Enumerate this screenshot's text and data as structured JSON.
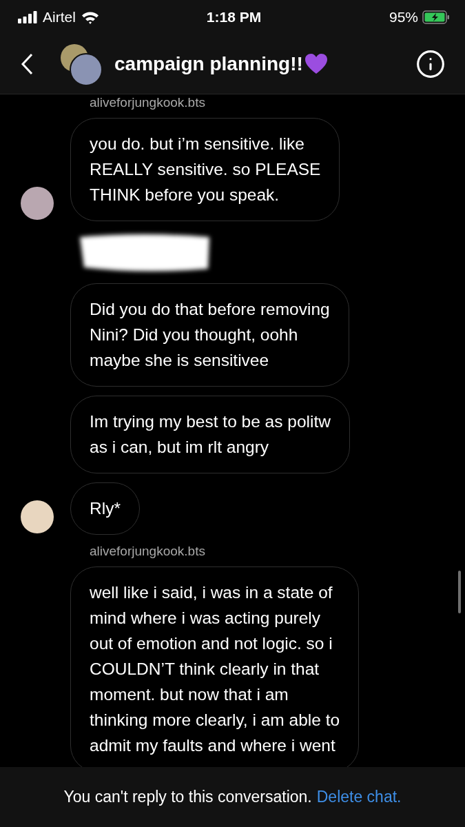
{
  "status_bar": {
    "carrier": "Airtel",
    "time": "1:18 PM",
    "battery": "95%"
  },
  "header": {
    "title": "campaign planning!!"
  },
  "messages": [
    {
      "kind": "sender",
      "text": "aliveforjungkook.bts"
    },
    {
      "kind": "bubble",
      "text": "you do. but i’m sensitive. like\nREALLY sensitive. so PLEASE\nTHINK before you speak.",
      "avatar": {
        "color": "#b9a7b0"
      }
    },
    {
      "kind": "redaction"
    },
    {
      "kind": "bubble",
      "text": "Did you do that before removing\nNini? Did you thought, oohh\nmaybe she is sensitivee"
    },
    {
      "kind": "bubble",
      "text": "Im trying my best to be as politw\nas i can, but im rlt angry"
    },
    {
      "kind": "bubble",
      "text": "Rly*",
      "avatar": {
        "color": "#e8d6bf"
      }
    },
    {
      "kind": "sender",
      "text": "aliveforjungkook.bts"
    },
    {
      "kind": "bubble",
      "text": "well like i said, i was in a state of\nmind where i was acting purely\nout of emotion and not logic. so i\nCOULDN’T think clearly in that\nmoment. but now that i am\nthinking more clearly, i am able to\nadmit my faults and where i went"
    }
  ],
  "footer": {
    "notice": "You can't reply to this conversation.",
    "link": "Delete chat."
  }
}
